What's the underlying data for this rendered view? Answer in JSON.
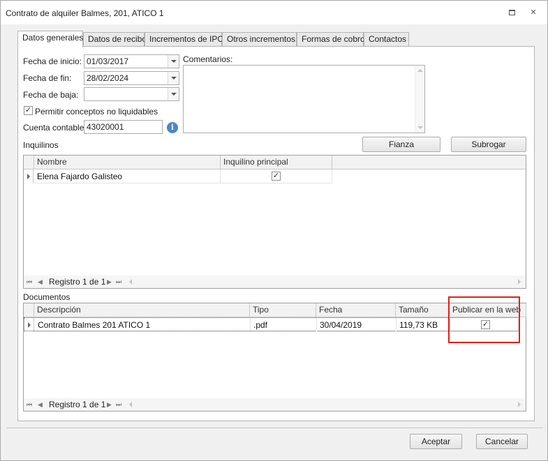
{
  "window": {
    "title": "Contrato de alquiler Balmes, 201, ATICO 1",
    "restore_glyph": "▭",
    "close_glyph": "✕"
  },
  "tabs": [
    {
      "label": "Datos generales",
      "active": true
    },
    {
      "label": "Datos de recibo"
    },
    {
      "label": "Incrementos de IPC"
    },
    {
      "label": "Otros incrementos"
    },
    {
      "label": "Formas de cobro"
    },
    {
      "label": "Contactos"
    }
  ],
  "general": {
    "fecha_inicio_label": "Fecha de inicio:",
    "fecha_inicio_value": "01/03/2017",
    "fecha_fin_label": "Fecha de fin:",
    "fecha_fin_value": "28/02/2024",
    "fecha_baja_label": "Fecha de baja:",
    "fecha_baja_value": "",
    "permitir_label": "Permitir conceptos no liquidables",
    "permitir_checked": true,
    "cuenta_label": "Cuenta contable:",
    "cuenta_value": "43020001",
    "comentarios_label": "Comentarios:",
    "info_glyph": "i"
  },
  "inquilinos": {
    "label": "Inquilinos",
    "fianza_button": "Fianza",
    "subrogar_button": "Subrogar",
    "columns": [
      "Nombre",
      "Inquilino principal"
    ],
    "rows": [
      {
        "nombre": "Elena Fajardo Galisteo",
        "principal": true
      }
    ],
    "nav_text": "Registro 1 de 1"
  },
  "documentos": {
    "label": "Documentos",
    "columns": [
      "Descripción",
      "Tipo",
      "Fecha",
      "Tamaño",
      "Publicar en la web"
    ],
    "rows": [
      {
        "descripcion": "Contrato Balmes 201 ATICO 1",
        "tipo": ".pdf",
        "fecha": "30/04/2019",
        "tamano": "119,73 KB",
        "publicar": true
      }
    ],
    "nav_text": "Registro 1 de 1"
  },
  "nav_glyphs": {
    "first": "⏮",
    "prev": "◀",
    "next": "▶",
    "last": "⏭"
  },
  "check_glyph": "✓",
  "footer": {
    "accept_button": "Aceptar",
    "cancel_button": "Cancelar"
  },
  "colors": {
    "highlight": "#e0201a",
    "info": "#4a86c8"
  }
}
